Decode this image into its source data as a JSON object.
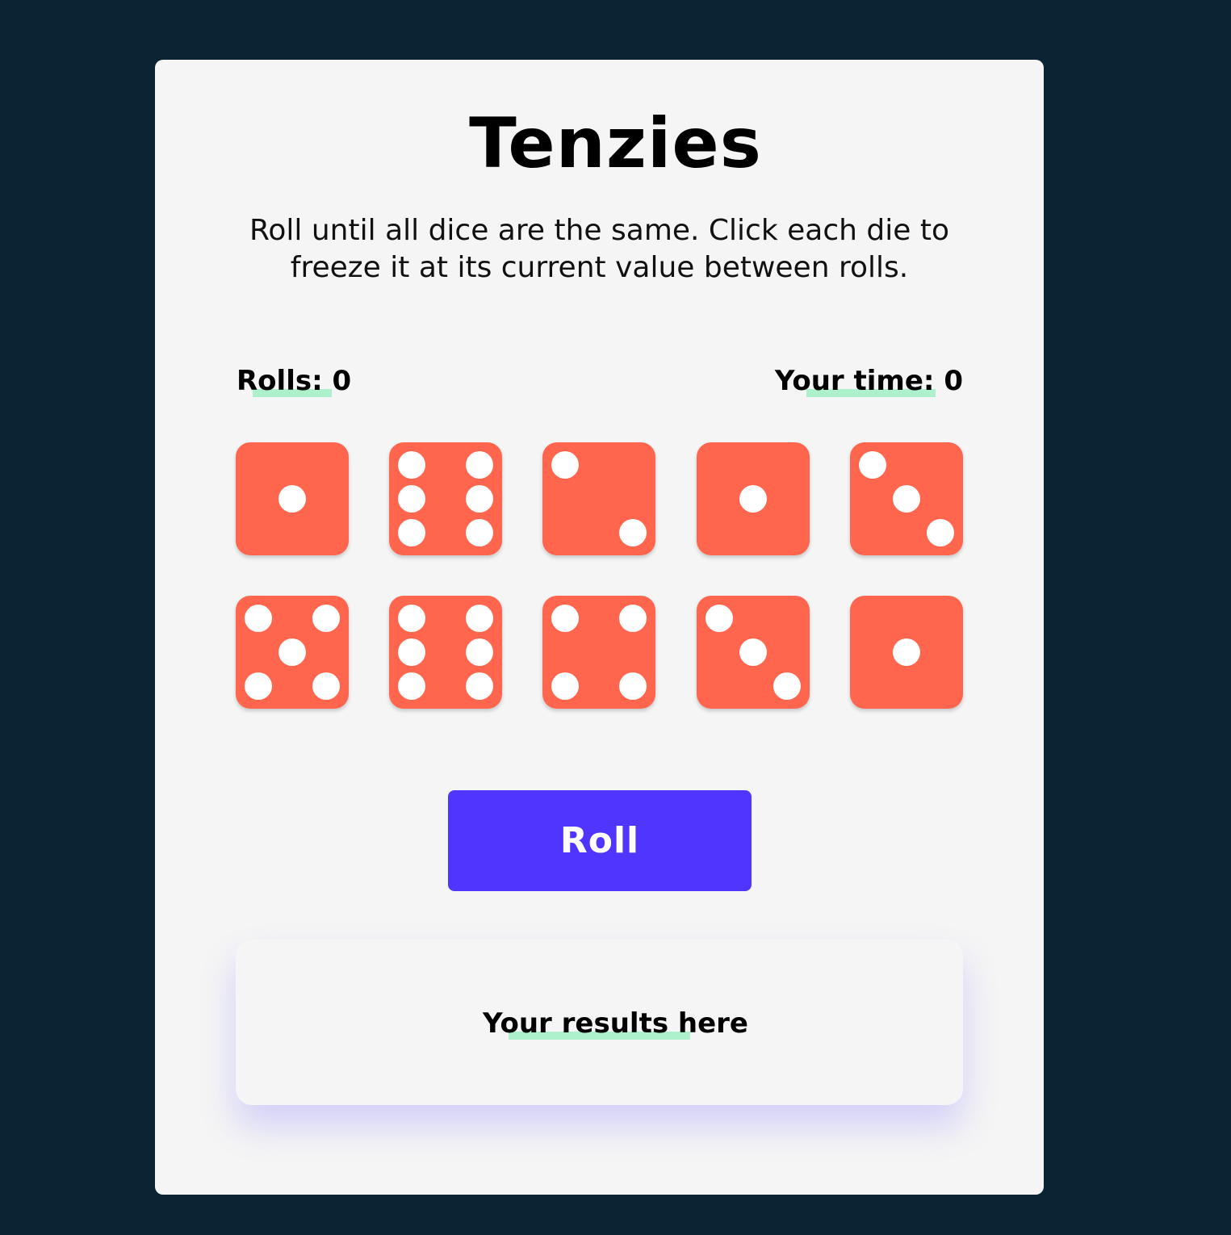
{
  "game": {
    "title": "Tenzies",
    "instructions": "Roll until all dice are the same. Click each die to freeze it at its current value between rolls.",
    "rolls_label": "Rolls: 0",
    "time_label": "Your time: 0",
    "roll_button_label": "Roll",
    "results_text": "Your results here",
    "dice": [
      1,
      6,
      2,
      1,
      3,
      5,
      6,
      4,
      3,
      1
    ],
    "colors": {
      "background": "#0b2434",
      "card": "#f5f5f5",
      "die": "#ff664d",
      "pip": "#ffffff",
      "button": "#5035ff",
      "highlight": "#adf0cc"
    }
  }
}
